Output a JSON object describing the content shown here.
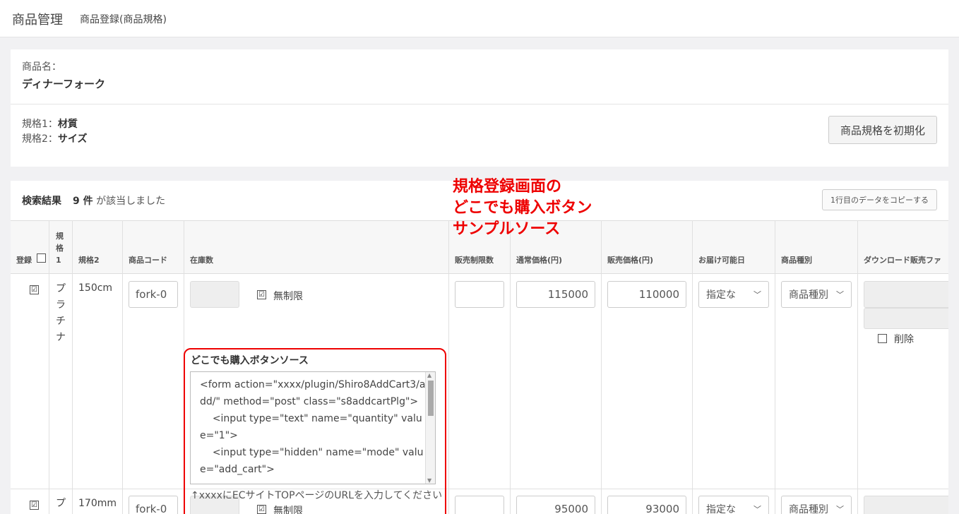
{
  "header": {
    "title": "商品管理",
    "subtitle": "商品登録(商品規格)"
  },
  "product": {
    "name_label": "商品名：",
    "name_value": "ディナーフォーク",
    "spec1_label": "規格1：",
    "spec1_value": "材質",
    "spec2_label": "規格2：",
    "spec2_value": "サイズ",
    "init_button": "商品規格を初期化"
  },
  "results": {
    "label": "検索結果",
    "count": "9 件",
    "suffix": "が該当しました",
    "copy_button": "1行目のデータをコピーする"
  },
  "columns": {
    "register": "登録",
    "spec1": "規格1",
    "spec2": "規格2",
    "code": "商品コード",
    "stock": "在庫数",
    "sale_limit": "販売制限数",
    "normal_price": "通常価格(円)",
    "sale_price": "販売価格(円)",
    "delivery": "お届け可能日",
    "type": "商品種別",
    "download": "ダウンロード販売ファ"
  },
  "rows": [
    {
      "checked": true,
      "spec1": "プラチナ",
      "spec2": "150cm",
      "code": "fork-0",
      "unlimited_label": "無制限",
      "unlimited": true,
      "normal_price": "115000",
      "sale_price": "110000",
      "delivery": "指定な",
      "type": "商品種別",
      "delete_label": "削除"
    },
    {
      "checked": true,
      "spec1": "プ",
      "spec2": "170mm",
      "code": "fork-0",
      "unlimited_label": "無制限",
      "unlimited": true,
      "normal_price": "95000",
      "sale_price": "93000",
      "delivery": "指定な",
      "type": "商品種別"
    }
  ],
  "callout": {
    "title": "どこでも購入ボタンソース",
    "code": "<form action=\"xxxx/plugin/Shiro8AddCart3/add/\" method=\"post\" class=\"s8addcartPlg\">\n    <input type=\"text\" name=\"quantity\" value=\"1\">\n    <input type=\"hidden\" name=\"mode\" value=\"add_cart\">",
    "note": "↑xxxxにECサイトTOPページのURLを入力してください"
  },
  "annotation": {
    "text": "規格登録画面の\nどこでも購入ボタン\nサンプルソース",
    "color": "#e00000"
  }
}
